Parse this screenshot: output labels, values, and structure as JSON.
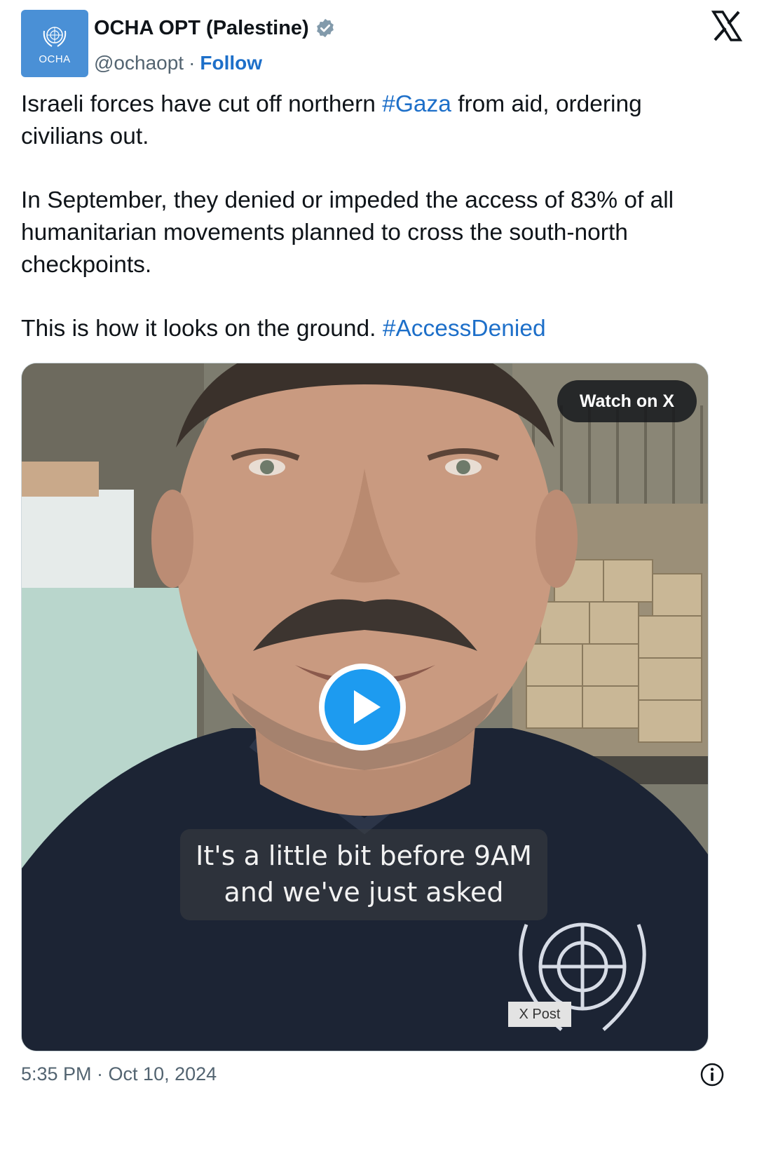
{
  "header": {
    "avatar_text": "OCHA",
    "display_name": "OCHA OPT (Palestine)",
    "handle": "@ochaopt",
    "separator": "·",
    "follow_label": "Follow",
    "verified_badge": "verified-badge-icon",
    "platform_logo": "x-logo-icon"
  },
  "tweet": {
    "p1_a": "Israeli forces have cut off northern ",
    "p1_tag": "#Gaza",
    "p1_b": " from aid, ordering civilians out.",
    "p2": "In September, they denied or impeded the access of 83% of all humanitarian movements planned to cross the south-north checkpoints.",
    "p3_a": "This is how it looks on the ground. ",
    "p3_tag": "#AccessDenied"
  },
  "media": {
    "watch_label": "Watch on X",
    "caption_line1": "It's a little bit before 9AM",
    "caption_line2": "and we've just asked",
    "badge": "X Post",
    "play_icon": "play-icon"
  },
  "footer": {
    "timestamp": "5:35 PM · Oct 10, 2024",
    "info_icon": "info-icon"
  },
  "colors": {
    "link": "#1d6fc9",
    "avatar_bg": "#4a90d6",
    "play_button": "#1d9bf0",
    "muted_text": "#536471"
  }
}
